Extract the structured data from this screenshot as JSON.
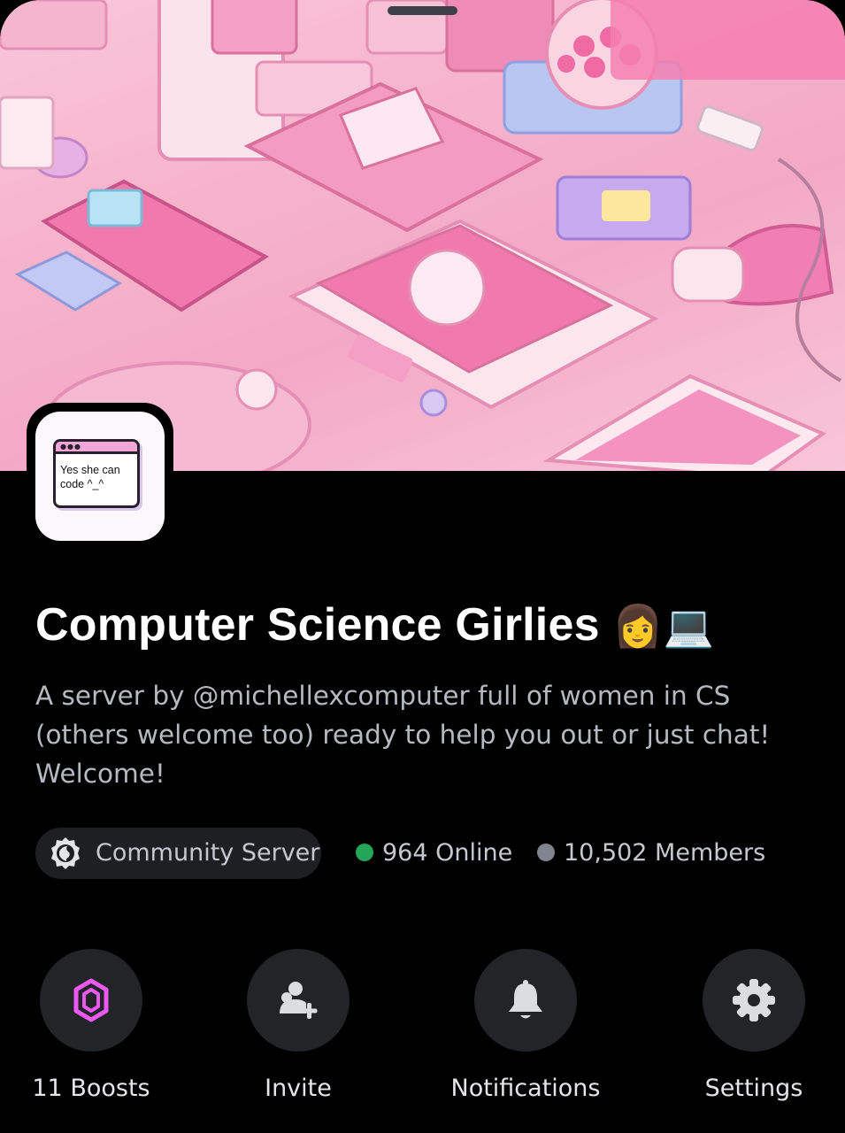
{
  "banner": {
    "description": "pink pixel-art desk with retro computers"
  },
  "server_icon": {
    "text": "Yes she can\ncode ^_^"
  },
  "server": {
    "name": "Computer Science Girlies",
    "name_emoji": "👩💻",
    "description": "A server by @michellexcomputer full of women in CS (others welcome too) ready to help you out or just chat! Welcome!"
  },
  "stats": {
    "community_label": "Community Server",
    "online": "964 Online",
    "members": "10,502 Members",
    "online_color": "#23a55a",
    "members_color": "#80848e"
  },
  "actions": [
    {
      "label": "11 Boosts",
      "icon": "boost-gem-icon",
      "color": "#eb59f2"
    },
    {
      "label": "Invite",
      "icon": "add-user-icon",
      "color": "#dbdee1"
    },
    {
      "label": "Notifications",
      "icon": "bell-icon",
      "color": "#dbdee1"
    },
    {
      "label": "Settings",
      "icon": "gear-icon",
      "color": "#dbdee1"
    }
  ]
}
